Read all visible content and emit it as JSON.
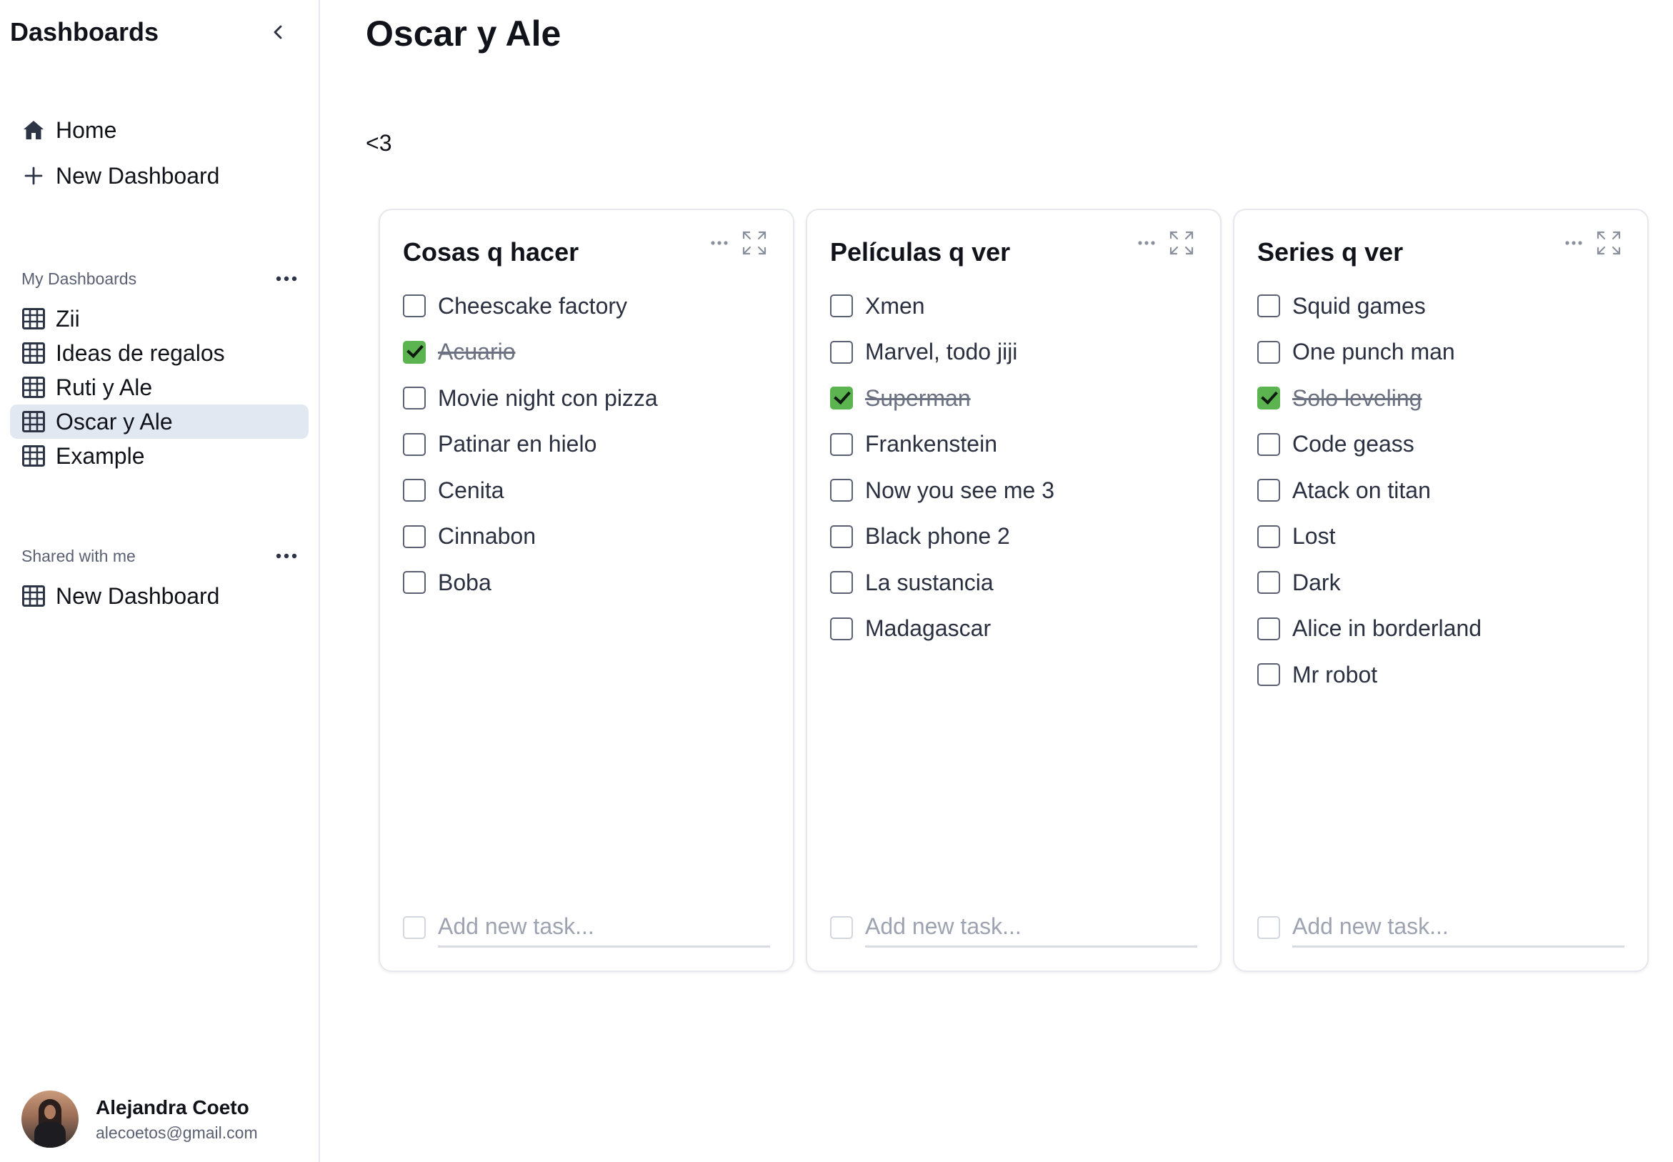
{
  "sidebar": {
    "title": "Dashboards",
    "nav": [
      {
        "label": "Home",
        "icon": "home-icon"
      },
      {
        "label": "New Dashboard",
        "icon": "plus-icon"
      }
    ],
    "my_dashboards_label": "My Dashboards",
    "my_dashboards": [
      {
        "label": "Zii",
        "active": false
      },
      {
        "label": "Ideas de regalos",
        "active": false
      },
      {
        "label": "Ruti y Ale",
        "active": false
      },
      {
        "label": "Oscar y Ale",
        "active": true
      },
      {
        "label": "Example",
        "active": false
      }
    ],
    "shared_label": "Shared with me",
    "shared": [
      {
        "label": "New Dashboard"
      }
    ],
    "user": {
      "name": "Alejandra Coeto",
      "email": "alecoetos@gmail.com"
    }
  },
  "main": {
    "title": "Oscar y Ale",
    "description": "<3",
    "columns": [
      {
        "title": "Cosas q hacer",
        "tasks": [
          {
            "label": "Cheescake factory",
            "done": false
          },
          {
            "label": "Acuario",
            "done": true
          },
          {
            "label": "Movie night con pizza",
            "done": false
          },
          {
            "label": "Patinar en hielo",
            "done": false
          },
          {
            "label": "Cenita",
            "done": false
          },
          {
            "label": "Cinnabon",
            "done": false
          },
          {
            "label": "Boba",
            "done": false
          }
        ],
        "add_placeholder": "Add new task..."
      },
      {
        "title": "Películas q ver",
        "tasks": [
          {
            "label": "Xmen",
            "done": false
          },
          {
            "label": "Marvel, todo jiji",
            "done": false
          },
          {
            "label": "Superman",
            "done": true
          },
          {
            "label": "Frankenstein",
            "done": false
          },
          {
            "label": "Now you see me 3",
            "done": false
          },
          {
            "label": "Black phone 2",
            "done": false
          },
          {
            "label": "La sustancia",
            "done": false
          },
          {
            "label": "Madagascar",
            "done": false
          }
        ],
        "add_placeholder": "Add new task..."
      },
      {
        "title": "Series q ver",
        "tasks": [
          {
            "label": "Squid games",
            "done": false
          },
          {
            "label": "One punch man",
            "done": false
          },
          {
            "label": "Solo leveling",
            "done": true
          },
          {
            "label": "Code geass",
            "done": false
          },
          {
            "label": "Atack on titan",
            "done": false
          },
          {
            "label": "Lost",
            "done": false
          },
          {
            "label": "Dark",
            "done": false
          },
          {
            "label": "Alice in borderland",
            "done": false
          },
          {
            "label": "Mr robot",
            "done": false
          }
        ],
        "add_placeholder": "Add new task..."
      }
    ]
  },
  "colors": {
    "checked": "#5bb450",
    "active_item_bg": "#e2e8f2"
  }
}
